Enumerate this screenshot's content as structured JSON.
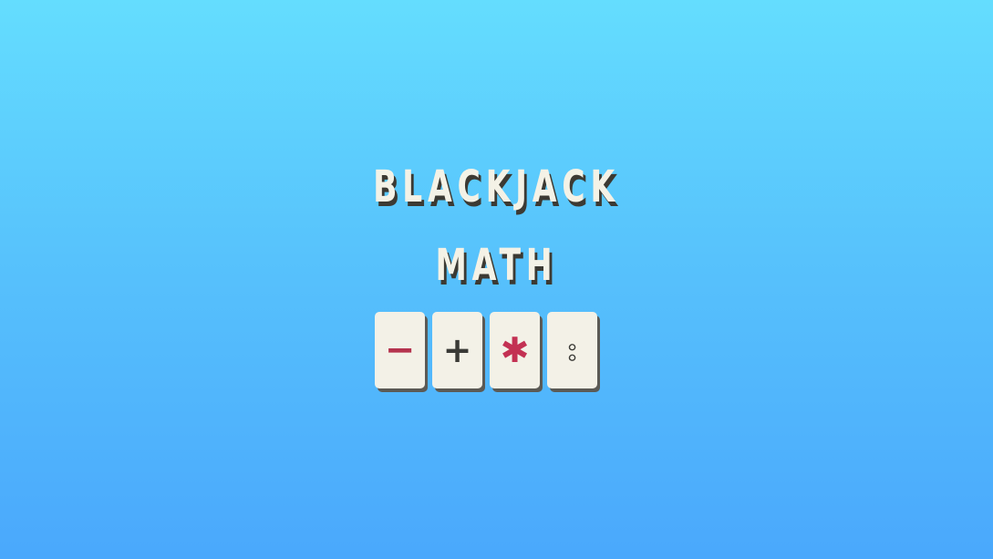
{
  "title": {
    "line1": "BLACKJACK",
    "line2": "MATH"
  },
  "operator_tiles": [
    {
      "symbol": "−",
      "icon": "minus-icon",
      "color": "#B5334E"
    },
    {
      "symbol": "+",
      "icon": "plus-icon",
      "color": "#3A3A36"
    },
    {
      "symbol": "✱",
      "icon": "asterisk-icon",
      "color": "#C33153"
    },
    {
      "symbol": "⦂",
      "icon": "division-icon",
      "color": "#3A3A36"
    }
  ],
  "colors": {
    "background_top": "#64DDFE",
    "background_bottom": "#4AA8FC",
    "title_text": "#F4F2E6",
    "title_shadow": "#3C3A33",
    "tile_face": "#F3F1E7"
  }
}
